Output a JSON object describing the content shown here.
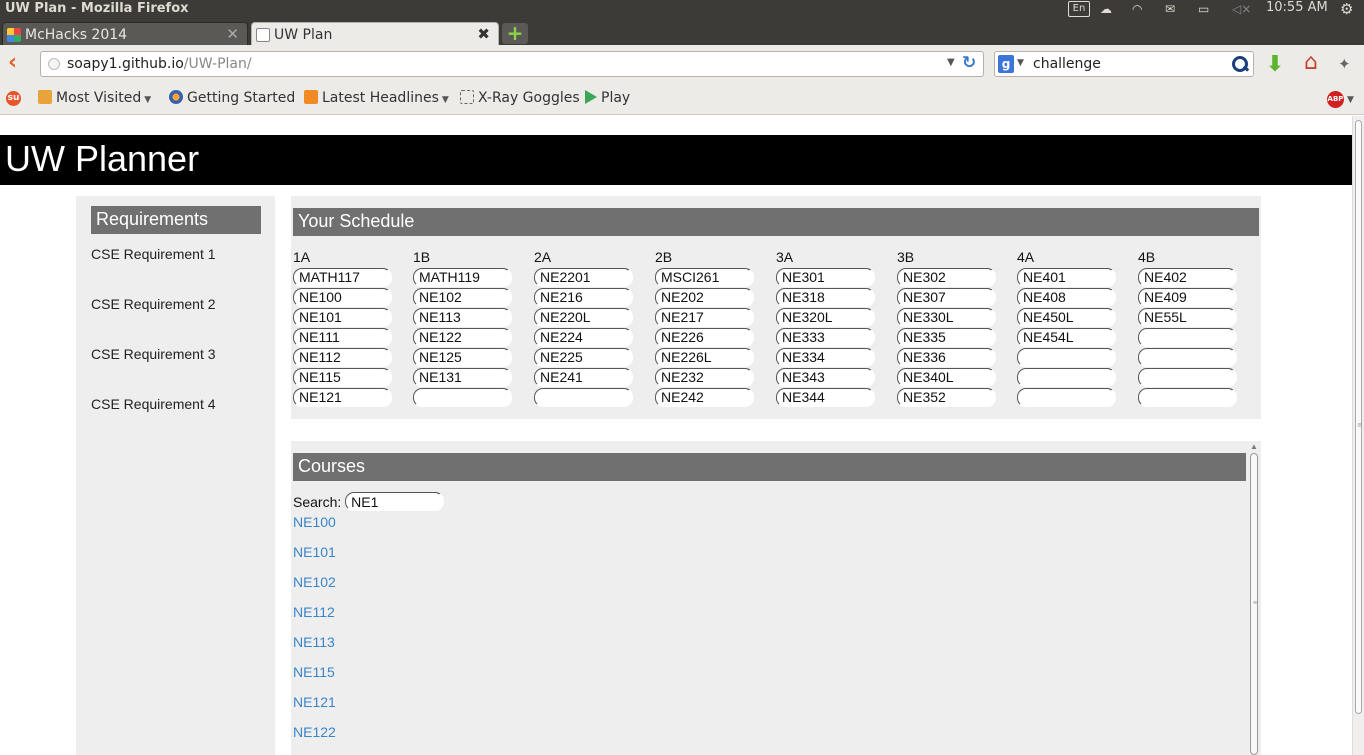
{
  "os": {
    "window_title": "UW Plan - Mozilla Firefox",
    "keyboard_layout": "En",
    "clock": "10:55 AM"
  },
  "browser": {
    "tabs": [
      {
        "label": "McHacks 2014",
        "active": false
      },
      {
        "label": "UW Plan",
        "active": true
      }
    ],
    "url_host": "soapy1.github.io",
    "url_path": "/UW-Plan/",
    "search_engine": "Google",
    "search_value": "challenge",
    "bookmarks": [
      {
        "label": "Most Visited",
        "has_dropdown": true
      },
      {
        "label": "Getting Started",
        "has_dropdown": false
      },
      {
        "label": "Latest Headlines",
        "has_dropdown": true
      },
      {
        "label": "X-Ray Goggles",
        "has_dropdown": false
      },
      {
        "label": "Play",
        "has_dropdown": false
      }
    ]
  },
  "site": {
    "title": "UW Planner",
    "requirements": {
      "heading": "Requirements",
      "items": [
        "CSE Requirement 1",
        "CSE Requirement 2",
        "CSE Requirement 3",
        "CSE Requirement 4"
      ]
    },
    "schedule": {
      "heading": "Your Schedule",
      "terms": [
        {
          "label": "1A",
          "courses": [
            "MATH117",
            "NE100",
            "NE101",
            "NE111",
            "NE112",
            "NE115",
            "NE121"
          ]
        },
        {
          "label": "1B",
          "courses": [
            "MATH119",
            "NE102",
            "NE113",
            "NE122",
            "NE125",
            "NE131",
            ""
          ]
        },
        {
          "label": "2A",
          "courses": [
            "NE2201",
            "NE216",
            "NE220L",
            "NE224",
            "NE225",
            "NE241",
            ""
          ]
        },
        {
          "label": "2B",
          "courses": [
            "MSCI261",
            "NE202",
            "NE217",
            "NE226",
            "NE226L",
            "NE232",
            "NE242"
          ]
        },
        {
          "label": "3A",
          "courses": [
            "NE301",
            "NE318",
            "NE320L",
            "NE333",
            "NE334",
            "NE343",
            "NE344"
          ]
        },
        {
          "label": "3B",
          "courses": [
            "NE302",
            "NE307",
            "NE330L",
            "NE335",
            "NE336",
            "NE340L",
            "NE352"
          ]
        },
        {
          "label": "4A",
          "courses": [
            "NE401",
            "NE408",
            "NE450L",
            "NE454L",
            "",
            "",
            ""
          ]
        },
        {
          "label": "4B",
          "courses": [
            "NE402",
            "NE409",
            "NE55L",
            "",
            "",
            "",
            ""
          ]
        }
      ]
    },
    "courses": {
      "heading": "Courses",
      "search_label": "Search:",
      "search_value": "NE1",
      "results": [
        "NE100",
        "NE101",
        "NE102",
        "NE112",
        "NE113",
        "NE115",
        "NE121",
        "NE122"
      ]
    }
  },
  "icons": {
    "back": "back-arrow-icon",
    "reload": "reload-icon",
    "download": "download-arrow-icon",
    "home": "home-icon",
    "adblock": "adblock-plus-icon"
  },
  "colors": {
    "header_bg": "#000000",
    "panel_bg": "#eeeeee",
    "heading_bar": "#707070",
    "link": "#3a85c8",
    "back_arrow": "#e0612a"
  }
}
